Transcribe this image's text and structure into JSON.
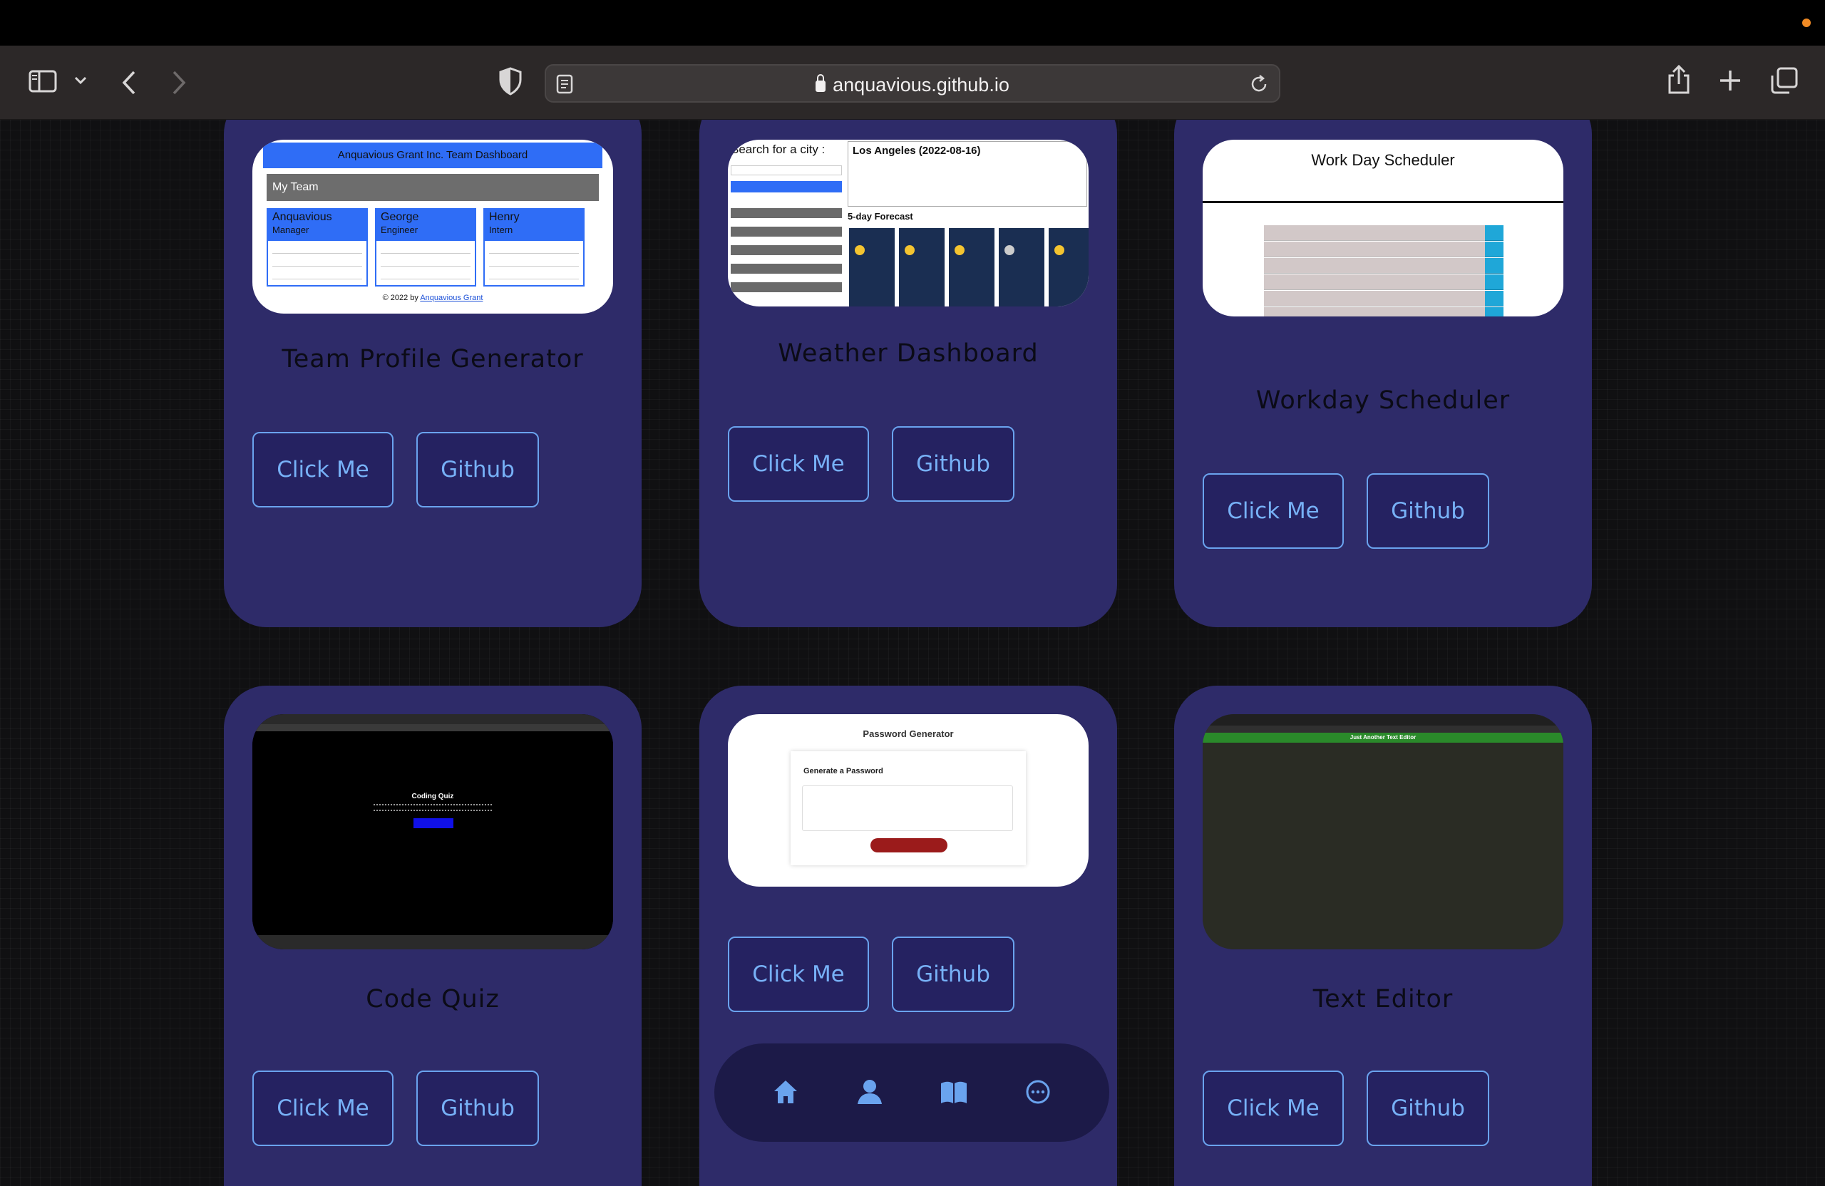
{
  "browser": {
    "url": "anquavious.github.io"
  },
  "projects": [
    {
      "title": "Team Profile Generator",
      "click_label": "Click Me",
      "github_label": "Github",
      "thumb": {
        "header": "Anquavious Grant Inc. Team Dashboard",
        "team_label": "My Team",
        "members": [
          {
            "name": "Anquavious",
            "role": "Manager"
          },
          {
            "name": "George",
            "role": "Engineer"
          },
          {
            "name": "Henry",
            "role": "Intern"
          }
        ],
        "footer_text": "© 2022 by",
        "footer_link": "Anquavious Grant"
      }
    },
    {
      "title": "Weather Dashboard",
      "click_label": "Click Me",
      "github_label": "Github",
      "thumb": {
        "search_label": "Search for a city :",
        "city_title": "Los Angeles (2022-08-16)",
        "forecast_label": "5-day Forecast"
      }
    },
    {
      "title": "Workday Scheduler",
      "click_label": "Click Me",
      "github_label": "Github",
      "thumb": {
        "header": "Work Day Scheduler"
      }
    },
    {
      "title": "Code Quiz",
      "click_label": "Click Me",
      "github_label": "Github",
      "thumb": {
        "header": "Coding Quiz"
      }
    },
    {
      "title": "",
      "click_label": "Click Me",
      "github_label": "Github",
      "thumb": {
        "header": "Password Generator",
        "subheader": "Generate a Password"
      }
    },
    {
      "title": "Text Editor",
      "click_label": "Click Me",
      "github_label": "Github",
      "thumb": {
        "header": "Just Another Text Editor"
      }
    }
  ],
  "nav": [
    {
      "icon": "home-icon"
    },
    {
      "icon": "user-icon"
    },
    {
      "icon": "book-icon"
    },
    {
      "icon": "chat-icon"
    }
  ],
  "colors": {
    "card_bg": "#2e2b69",
    "button_border": "#6aa3ee",
    "button_text": "#77b1f7",
    "nav_bg": "#1c1a48"
  }
}
